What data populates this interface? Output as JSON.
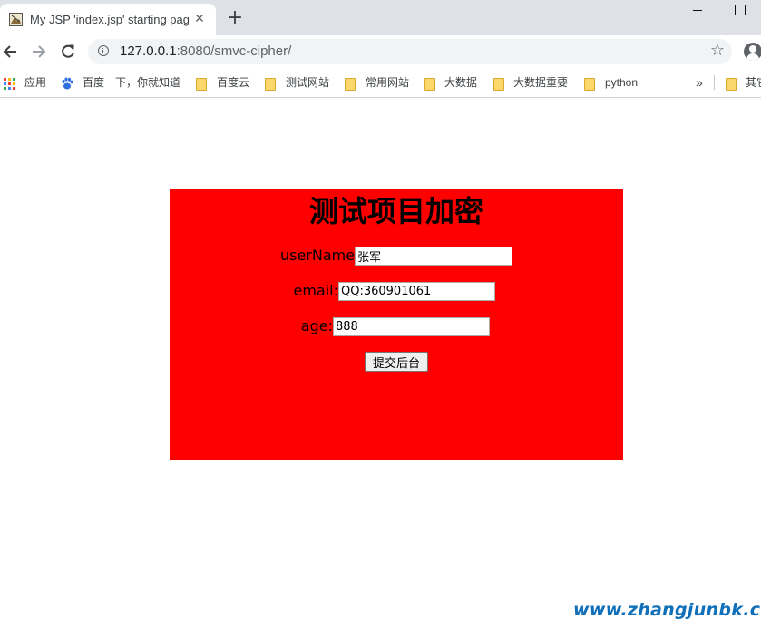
{
  "tab": {
    "title": "My JSP 'index.jsp' starting page",
    "close_glyph": "✕",
    "new_tab_glyph": "+"
  },
  "address_bar": {
    "host": "127.0.0.1",
    "rest": ":8080/smvc-cipher/"
  },
  "bookmarks": [
    {
      "label": "应用",
      "icon": "apps-icon"
    },
    {
      "label": "百度一下，你就知道",
      "icon": "baidu-paw-icon"
    },
    {
      "label": "百度云",
      "icon": "folder-icon"
    },
    {
      "label": "测试网站",
      "icon": "folder-icon"
    },
    {
      "label": "常用网站",
      "icon": "folder-icon"
    },
    {
      "label": "大数据",
      "icon": "folder-icon"
    },
    {
      "label": "大数据重要",
      "icon": "folder-icon"
    },
    {
      "label": "python",
      "icon": "folder-icon"
    },
    {
      "label": "其它",
      "icon": "folder-icon"
    }
  ],
  "bookmarks_overflow": "»",
  "form": {
    "title": "测试项目加密",
    "username_label": "userName:",
    "username_value": "张军",
    "email_label": "email:",
    "email_value": "QQ:360901061",
    "age_label": "age:",
    "age_value": "888",
    "submit_label": "提交后台"
  },
  "watermark": "www.zhangjunbk.com",
  "colors": {
    "panel": "#ff0000",
    "tabstrip": "#dee1e6",
    "omnibox": "#f1f3f4",
    "watermark": "#0f6fb8"
  }
}
